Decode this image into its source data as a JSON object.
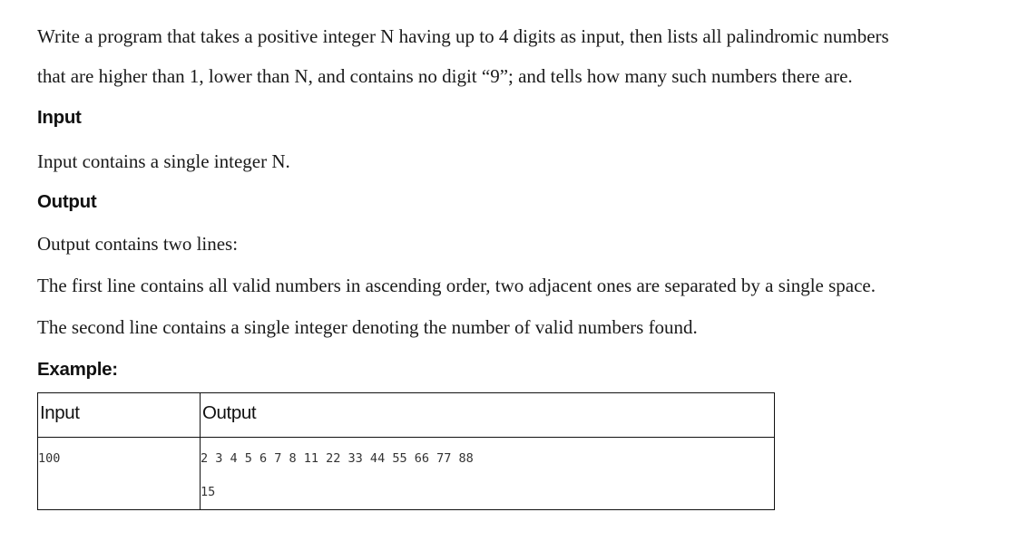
{
  "problem": {
    "statement_line1": "Write a program that takes a positive integer N having up to 4 digits as input, then lists all palindromic numbers",
    "statement_line2": "that are higher than 1, lower than N, and contains no digit “9”; and tells how many such numbers there are.",
    "input_heading": "Input",
    "input_text": "Input contains a single integer N.",
    "output_heading": "Output",
    "output_text1": "Output contains two lines:",
    "output_text2": "The first line contains all valid numbers in ascending order, two adjacent ones are separated by a single space.",
    "output_text3": "The second line contains a single integer denoting the number of valid numbers found.",
    "example_heading": "Example:"
  },
  "example_table": {
    "headers": [
      "Input",
      "Output"
    ],
    "input_value": "100",
    "output_line1": "2 3 4 5 6 7 8 11 22 33 44 55 66 77 88",
    "output_line2": "15"
  }
}
